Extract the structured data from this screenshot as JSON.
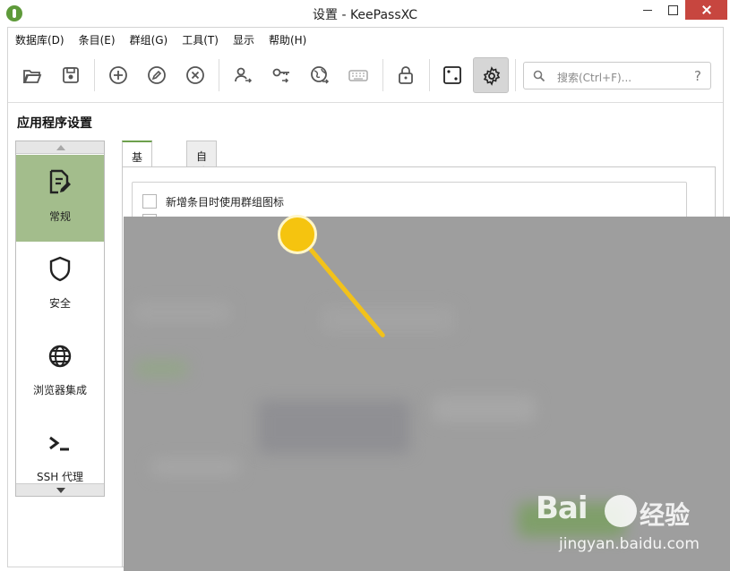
{
  "window": {
    "title": "设置 - KeePassXC"
  },
  "menubar": {
    "items": [
      "数据库(D)",
      "条目(E)",
      "群组(G)",
      "工具(T)",
      "显示",
      "帮助(H)"
    ]
  },
  "toolbar": {
    "buttons": [
      {
        "icon": "folder-open-icon"
      },
      {
        "icon": "save-icon"
      },
      {
        "icon": "add-entry-icon"
      },
      {
        "icon": "edit-entry-icon"
      },
      {
        "icon": "delete-entry-icon"
      },
      {
        "icon": "copy-username-icon"
      },
      {
        "icon": "copy-password-icon"
      },
      {
        "icon": "copy-url-icon"
      },
      {
        "icon": "auto-type-icon"
      },
      {
        "icon": "lock-icon"
      },
      {
        "icon": "password-generator-icon"
      },
      {
        "icon": "settings-icon",
        "active": true
      }
    ],
    "search": {
      "placeholder": "搜索(Ctrl+F)...",
      "help": "?"
    }
  },
  "page": {
    "title": "应用程序设置"
  },
  "categories": [
    {
      "label": "常规",
      "icon": "document-edit-icon",
      "selected": true
    },
    {
      "label": "安全",
      "icon": "shield-icon",
      "selected": false
    },
    {
      "label": "浏览器集成",
      "icon": "globe-icon",
      "selected": false
    },
    {
      "label": "SSH 代理",
      "icon": "terminal-icon",
      "selected": false
    }
  ],
  "tabs": [
    {
      "label": "基础设置",
      "active": true
    },
    {
      "label": "自动输入",
      "active": false
    }
  ],
  "settings": {
    "checkbox_1": {
      "label": "新增条目时使用群组图标",
      "checked": false
    }
  },
  "watermark": {
    "brand": "Bai",
    "brand_cn": "经验",
    "url": "jingyan.baidu.com"
  },
  "colors": {
    "accent": "#6da04c",
    "selected_category": "#a3bd8c",
    "pointer": "#f5c40f",
    "close_button": "#c7463f"
  }
}
